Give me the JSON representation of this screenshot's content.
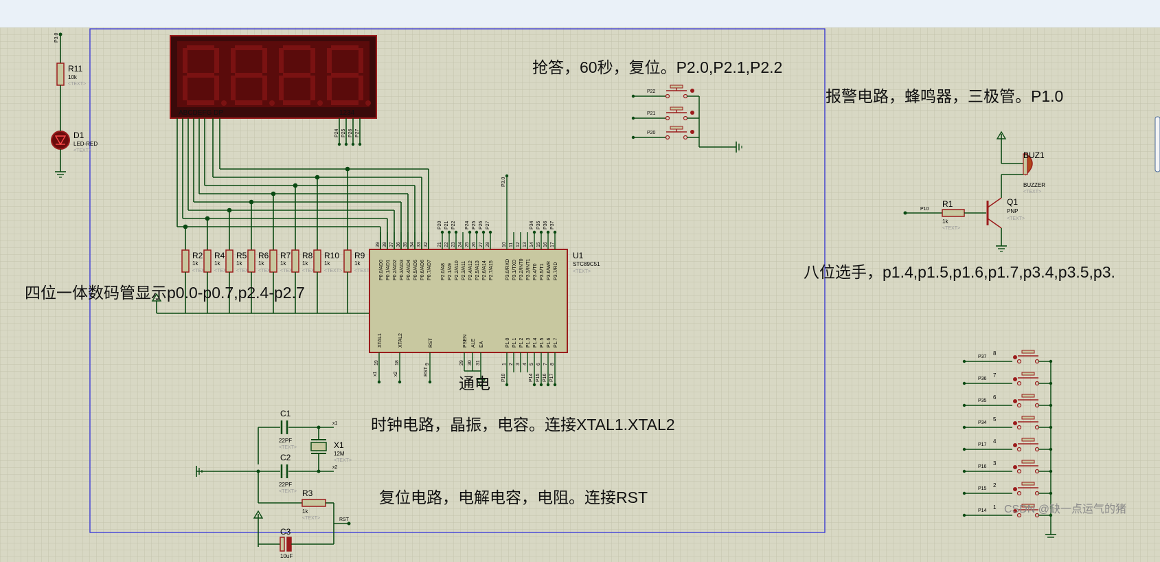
{
  "window": {
    "watermark": "CSDN @缺一点运气的猪"
  },
  "notes": {
    "qiangda": "抢答，60秒，复位。P2.0,P2.1,P2.2",
    "alarm": "报警电路，蜂鸣器，三极管。P1.0",
    "players": "八位选手，p1.4,p1.5,p1.6,p1.7,p3.4,p3.5,p3.",
    "display": "四位一体数码管显示p0.0-p0.7,p2.4-p2.7",
    "power": "通电",
    "clock": "时钟电路，晶振，电容。连接XTAL1.XTAL2",
    "reset": "复位电路，电解电容，电阻。连接RST"
  },
  "colors": {
    "wire": "#0b4a13",
    "body": "#9b1c1c",
    "chip_fill": "#c8c8a0",
    "grid": "#c3c3ad",
    "sheet": "#2a2adc"
  },
  "led_display": {
    "segments": "ABCDEFG DP",
    "digits": "1234",
    "value": "8.8.8.8."
  },
  "mcu": {
    "ref": "U1",
    "part": "STC89C51",
    "text": "<TEXT>",
    "p0_pins": [
      "P0.0/AD0",
      "P0.1/AD1",
      "P0.2/AD2",
      "P0.3/AD3",
      "P0.4/AD4",
      "P0.5/AD5",
      "P0.6/AD6",
      "P0.7/AD7"
    ],
    "p0_nums": [
      "39",
      "38",
      "37",
      "36",
      "35",
      "34",
      "33",
      "32"
    ],
    "p2_pins": [
      "P2.0/A8",
      "P2.1/A9",
      "P2.2/A10",
      "P2.3/A11",
      "P2.4/A12",
      "P2.5/A13",
      "P2.6/A14",
      "P2.7/A15"
    ],
    "p2_nums": [
      "21",
      "22",
      "23",
      "24",
      "25",
      "26",
      "27",
      "28"
    ],
    "p3_pins": [
      "P3.0/RXD",
      "P3.1/TXD",
      "P3.2/INT0",
      "P3.3/INT1",
      "P3.4/T0",
      "P3.5/T1",
      "P3.6/WR",
      "P3.7/RD"
    ],
    "p3_nums": [
      "10",
      "11",
      "12",
      "13",
      "14",
      "15",
      "16",
      "17"
    ],
    "p1_pins": [
      "P1.0",
      "P1.1",
      "P1.2",
      "P1.3",
      "P1.4",
      "P1.5",
      "P1.6",
      "P1.7"
    ],
    "p1_nums": [
      "1",
      "2",
      "3",
      "4",
      "5",
      "6",
      "7",
      "8"
    ],
    "bottom_pins": [
      "XTAL1",
      "XTAL2",
      "RST",
      "PSEN",
      "ALE",
      "EA"
    ],
    "bottom_nums": [
      "19",
      "18",
      "9",
      "29",
      "30",
      "31"
    ]
  },
  "resistors": {
    "array": [
      {
        "ref": "R2",
        "val": "1k"
      },
      {
        "ref": "R4",
        "val": "1k"
      },
      {
        "ref": "R5",
        "val": "1k"
      },
      {
        "ref": "R6",
        "val": "1k"
      },
      {
        "ref": "R7",
        "val": "1k"
      },
      {
        "ref": "R8",
        "val": "1k"
      },
      {
        "ref": "R10",
        "val": "1k"
      },
      {
        "ref": "R9",
        "val": "1k"
      }
    ],
    "r11": {
      "ref": "R11",
      "val": "10k"
    },
    "r1": {
      "ref": "R1",
      "val": "1k"
    },
    "r3": {
      "ref": "R3",
      "val": "1k"
    }
  },
  "led": {
    "ref": "D1",
    "part": "LED-RED",
    "net": "P3.0"
  },
  "buzzer": {
    "ref": "BUZ1",
    "part": "BUZZER"
  },
  "transistor": {
    "ref": "Q1",
    "part": "PNP",
    "net": "P10"
  },
  "caps": [
    {
      "ref": "C1",
      "val": "22PF"
    },
    {
      "ref": "C2",
      "val": "22PF"
    },
    {
      "ref": "C3",
      "val": "10uF"
    }
  ],
  "crystal": {
    "ref": "X1",
    "val": "12M",
    "net1": "x1",
    "net2": "x2"
  },
  "reset_net": "RST",
  "text_placeholder": "<TEXT>",
  "top_buttons": [
    "P22",
    "P21",
    "P20"
  ],
  "player_buttons": [
    {
      "net": "P37",
      "num": "8"
    },
    {
      "net": "P36",
      "num": "7"
    },
    {
      "net": "P35",
      "num": "6"
    },
    {
      "net": "P34",
      "num": "5"
    },
    {
      "net": "P17",
      "num": "4"
    },
    {
      "net": "P16",
      "num": "3"
    },
    {
      "net": "P15",
      "num": "2"
    },
    {
      "net": "P14",
      "num": "1"
    }
  ],
  "net_labels": {
    "digit_nets": [
      "P24",
      "P25",
      "P26",
      "P27"
    ],
    "p2_top": [
      "P20",
      "P21",
      "P22",
      "P24",
      "P25",
      "P26",
      "P27"
    ],
    "p3_top": [
      "P3.0",
      "P34",
      "P35",
      "P36",
      "P37"
    ],
    "p1_bottom": [
      "P10",
      "P14",
      "P15",
      "P16",
      "P17"
    ],
    "xtal": [
      "x1",
      "x2",
      "RST"
    ]
  }
}
